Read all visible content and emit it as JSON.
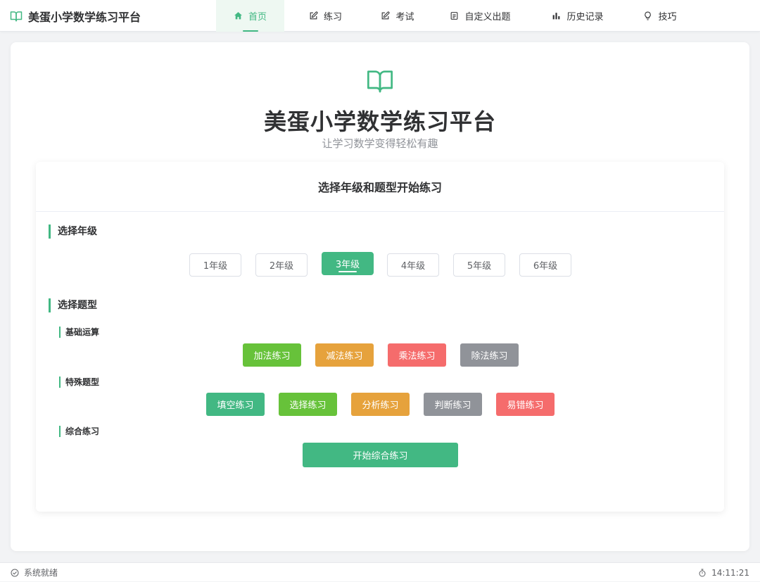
{
  "app": {
    "title": "美蛋小学数学练习平台",
    "brand_icon": "book-icon"
  },
  "nav": {
    "items": [
      {
        "label": "首页",
        "icon": "home-icon",
        "active": true
      },
      {
        "label": "练习",
        "icon": "edit-icon",
        "active": false
      },
      {
        "label": "考试",
        "icon": "edit-icon",
        "active": false
      },
      {
        "label": "自定义出题",
        "icon": "document-icon",
        "active": false
      },
      {
        "label": "历史记录",
        "icon": "bar-chart-icon",
        "active": false
      },
      {
        "label": "技巧",
        "icon": "lightbulb-icon",
        "active": false
      }
    ]
  },
  "hero": {
    "icon": "open-book-icon",
    "title": "美蛋小学数学练习平台",
    "subtitle": "让学习数学变得轻松有趣"
  },
  "card": {
    "header": "选择年级和题型开始练习",
    "grade_section": {
      "title": "选择年级",
      "grades": [
        "1年级",
        "2年级",
        "3年级",
        "4年级",
        "5年级",
        "6年级"
      ],
      "selected": "3年级"
    },
    "type_section": {
      "title": "选择题型",
      "basic": {
        "title": "基础运算",
        "buttons": [
          "加法练习",
          "减法练习",
          "乘法练习",
          "除法练习"
        ]
      },
      "special": {
        "title": "特殊题型",
        "buttons": [
          "填空练习",
          "选择练习",
          "分析练习",
          "判断练习",
          "易错练习"
        ]
      },
      "comprehensive": {
        "title": "综合练习",
        "button": "开始综合练习"
      }
    }
  },
  "colors": {
    "accent": "#42b883",
    "success": "#67c23a",
    "warning": "#e6a23c",
    "danger": "#f56c6c",
    "info": "#909399"
  },
  "status": {
    "text": "系统就绪",
    "time": "14:11:21",
    "status_icon": "check-circle-icon",
    "time_icon": "stopwatch-icon"
  }
}
